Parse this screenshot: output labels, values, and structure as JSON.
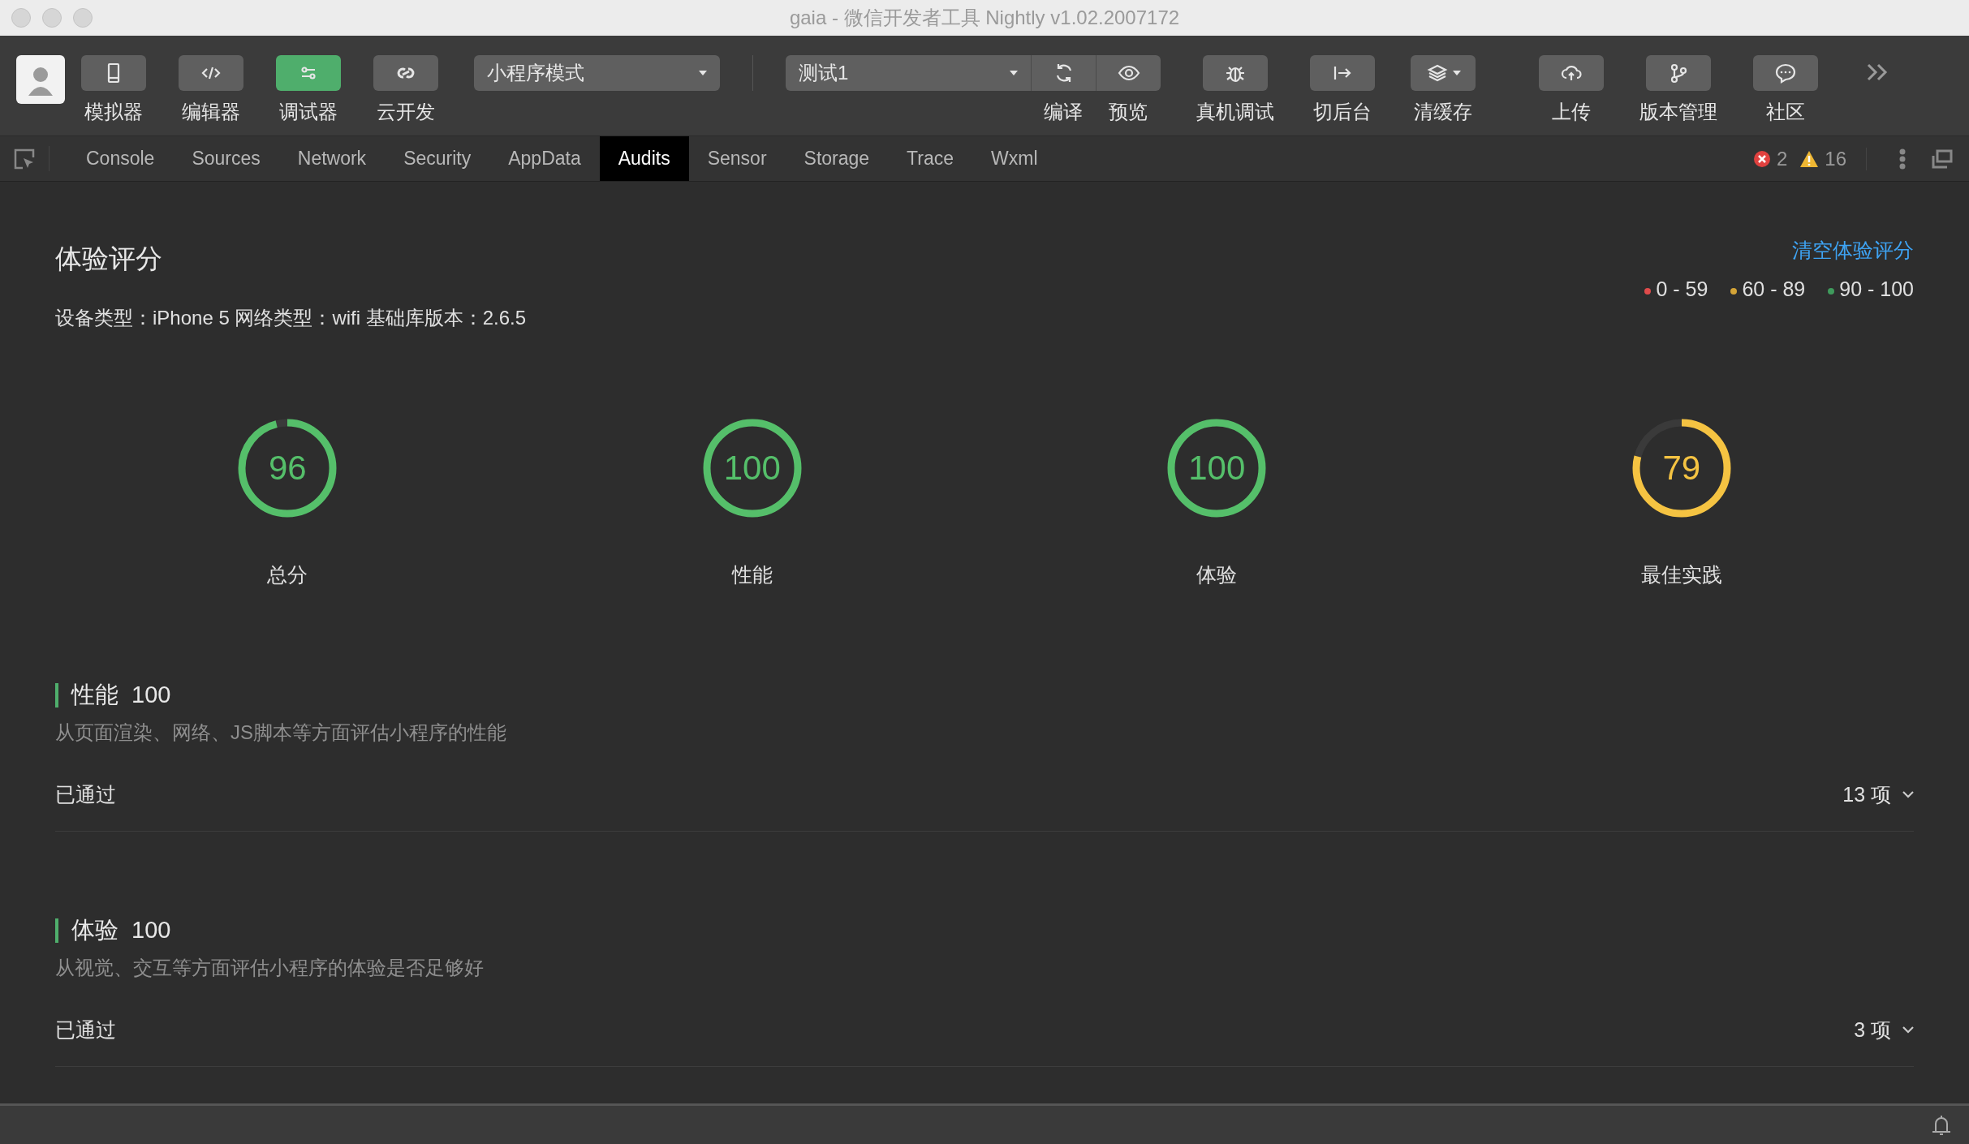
{
  "window": {
    "title": "gaia - 微信开发者工具 Nightly v1.02.2007172"
  },
  "toolbar": {
    "left_buttons": [
      {
        "label": "模拟器",
        "selected": false
      },
      {
        "label": "编辑器",
        "selected": false
      },
      {
        "label": "调试器",
        "selected": true
      },
      {
        "label": "云开发",
        "selected": false
      }
    ],
    "mode_select": "小程序模式",
    "compile_select": "测试1",
    "compile_buttons": [
      {
        "label": "编译"
      },
      {
        "label": "预览"
      }
    ],
    "right_buttons": [
      {
        "label": "真机调试",
        "dropdown": false
      },
      {
        "label": "切后台",
        "dropdown": false
      },
      {
        "label": "清缓存",
        "dropdown": true
      }
    ],
    "far_right_buttons": [
      {
        "label": "上传"
      },
      {
        "label": "版本管理"
      },
      {
        "label": "社区"
      }
    ]
  },
  "devtools_tabs": [
    {
      "label": "Console",
      "selected": false
    },
    {
      "label": "Sources",
      "selected": false
    },
    {
      "label": "Network",
      "selected": false
    },
    {
      "label": "Security",
      "selected": false
    },
    {
      "label": "AppData",
      "selected": false
    },
    {
      "label": "Audits",
      "selected": true
    },
    {
      "label": "Sensor",
      "selected": false
    },
    {
      "label": "Storage",
      "selected": false
    },
    {
      "label": "Trace",
      "selected": false
    },
    {
      "label": "Wxml",
      "selected": false
    }
  ],
  "error_count": "2",
  "warning_count": "16",
  "audits": {
    "title": "体验评分",
    "clear_link": "清空体验评分",
    "device_info": "设备类型：iPhone 5 网络类型：wifi 基础库版本：2.6.5",
    "legend": [
      {
        "label": "0 - 59",
        "color": "#e04b4b"
      },
      {
        "label": "60 - 89",
        "color": "#d4a437"
      },
      {
        "label": "90 - 100",
        "color": "#3f9a5c"
      }
    ],
    "gauges": [
      {
        "score": "96",
        "label": "总分",
        "level": 0.96,
        "color": "#55bf6a"
      },
      {
        "score": "100",
        "label": "性能",
        "level": 1,
        "color": "#55bf6a"
      },
      {
        "score": "100",
        "label": "体验",
        "level": 1,
        "color": "#55bf6a"
      },
      {
        "score": "79",
        "label": "最佳实践",
        "level": 0.79,
        "color": "#f5c342"
      }
    ],
    "sections": [
      {
        "title": "性能",
        "score": "100",
        "description": "从页面渲染、网络、JS脚本等方面评估小程序的性能",
        "passed_label": "已通过",
        "count": "13 项"
      },
      {
        "title": "体验",
        "score": "100",
        "description": "从视觉、交互等方面评估小程序的体验是否足够好",
        "passed_label": "已通过",
        "count": "3 项"
      }
    ]
  }
}
